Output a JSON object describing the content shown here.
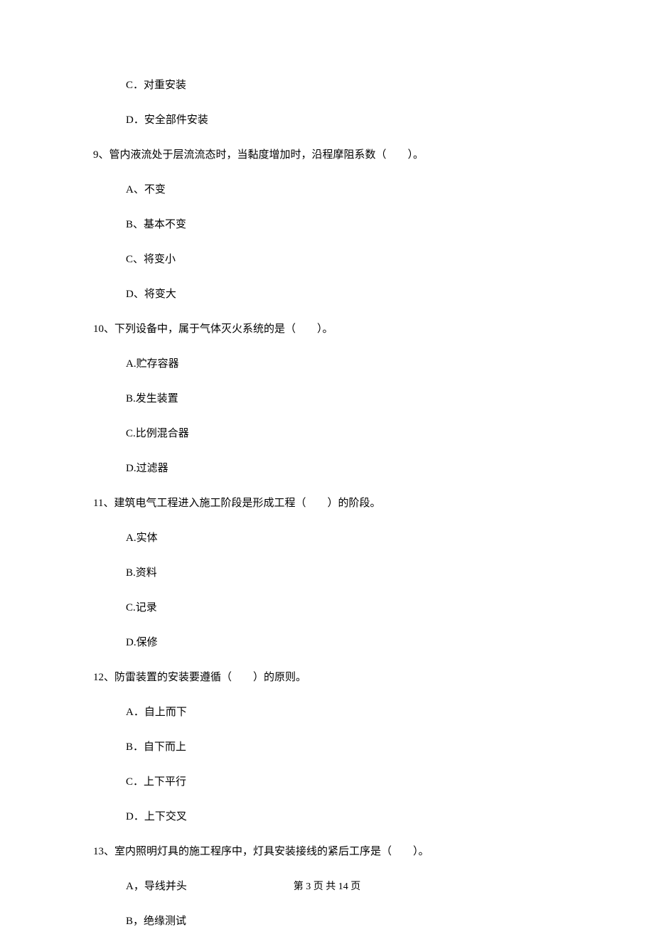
{
  "options_top": [
    "C．对重安装",
    "D．安全部件安装"
  ],
  "q9": {
    "stem": "9、管内液流处于层流流态时，当黏度增加时，沿程摩阻系数（　　）。",
    "opts": [
      "A、不变",
      "B、基本不变",
      "C、将变小",
      "D、将变大"
    ]
  },
  "q10": {
    "stem": "10、下列设备中，属于气体灭火系统的是（　　）。",
    "opts": [
      "A.贮存容器",
      "B.发生装置",
      "C.比例混合器",
      "D.过滤器"
    ]
  },
  "q11": {
    "stem": "11、建筑电气工程进入施工阶段是形成工程（　　）的阶段。",
    "opts": [
      "A.实体",
      "B.资料",
      "C.记录",
      "D.保修"
    ]
  },
  "q12": {
    "stem": "12、防雷装置的安装要遵循（　　）的原则。",
    "opts": [
      "A．自上而下",
      "B．自下而上",
      "C．上下平行",
      "D．上下交叉"
    ]
  },
  "q13": {
    "stem": "13、室内照明灯具的施工程序中，灯具安装接线的紧后工序是（　　）。",
    "opts": [
      "A，导线并头",
      "B，绝缘测试"
    ]
  },
  "footer": "第 3 页 共 14 页"
}
